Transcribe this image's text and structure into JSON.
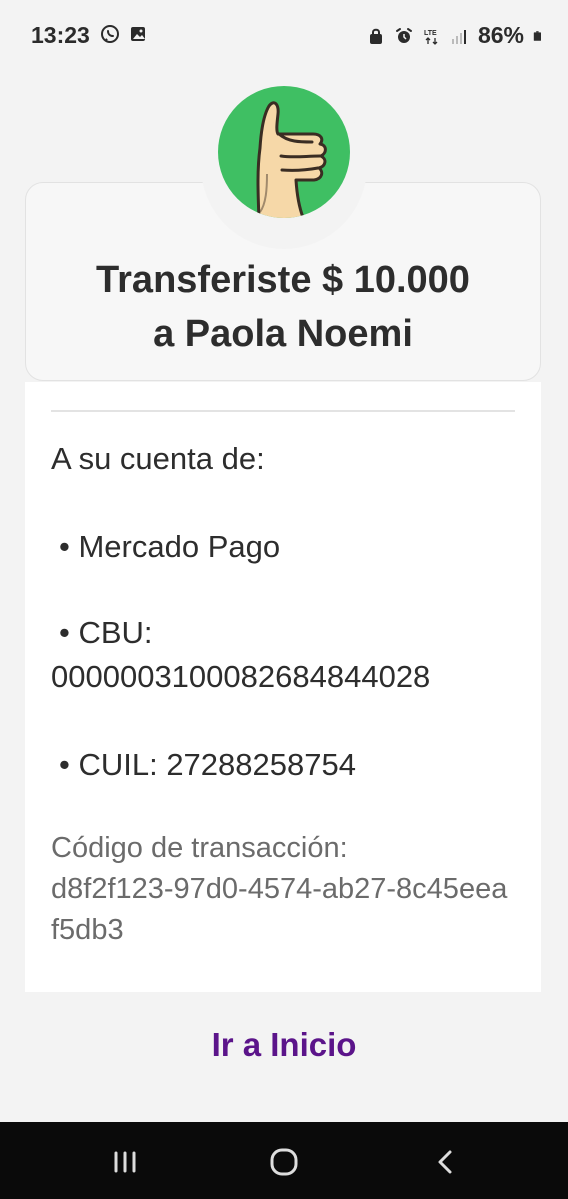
{
  "status_bar": {
    "time": "13:23",
    "battery": "86%",
    "icons": [
      "whatsapp-icon",
      "image-icon",
      "lock-icon",
      "alarm-icon",
      "lte-icon",
      "signal-icon",
      "battery-icon"
    ]
  },
  "success_icon": "thumbs-up-icon",
  "summary": {
    "title_line_1": "Transferiste $ 10.000",
    "title_line_2": "a Paola Noemi"
  },
  "details": {
    "account_heading": "A su cuenta de:",
    "bank": "• Mercado Pago",
    "cbu_label": "• CBU:",
    "cbu_value": "0000003100082684844028",
    "cuil": "• CUIL: 27288258754",
    "transaction_label": "Código de transacción:",
    "transaction_id": "d8f2f123-97d0-4574-ab27-8c45eeaf5db3"
  },
  "actions": {
    "go_home": "Ir a Inicio"
  },
  "navigation": {
    "buttons": [
      "recent-apps-icon",
      "home-icon",
      "back-icon"
    ]
  },
  "colors": {
    "accent": "#5b148a",
    "success": "#3fbf63",
    "card_background": "#ffffff",
    "screen_background": "#f3f3f3"
  }
}
